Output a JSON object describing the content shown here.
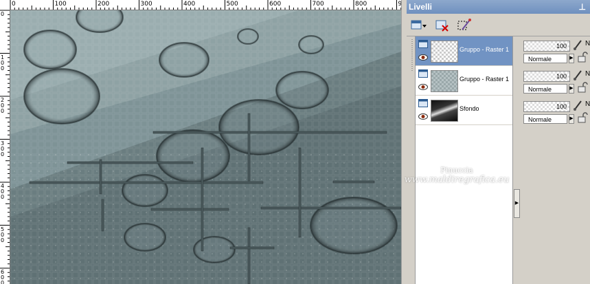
{
  "ruler": {
    "top_labels": [
      "0",
      "100",
      "200",
      "300",
      "400",
      "500",
      "600",
      "700",
      "800",
      "900"
    ],
    "left_labels": [
      "0",
      "100",
      "200",
      "300",
      "400",
      "500",
      "600"
    ]
  },
  "palette": {
    "title": "Livelli",
    "pin_icon": "pin-icon",
    "toolbar_icons": [
      "new-layer-icon",
      "delete-layer-icon",
      "edit-selection-icon"
    ],
    "layers": [
      {
        "name": "Gruppo - Raster 1",
        "selected": true,
        "opacity": "100",
        "blend": "Normale"
      },
      {
        "name": "Gruppo - Raster 1",
        "selected": false,
        "opacity": "100",
        "blend": "Normale"
      },
      {
        "name": "Sfondo",
        "selected": false,
        "opacity": "100",
        "blend": "Normale"
      }
    ],
    "truncated_label": "N"
  },
  "colors": {
    "selection": "#7193c3",
    "title_bar": "#6f90bf",
    "canvas_base": "#6d7f82"
  },
  "watermark": {
    "line1": "Pinuccia",
    "line2": "www.maldiregrafica.eu"
  }
}
